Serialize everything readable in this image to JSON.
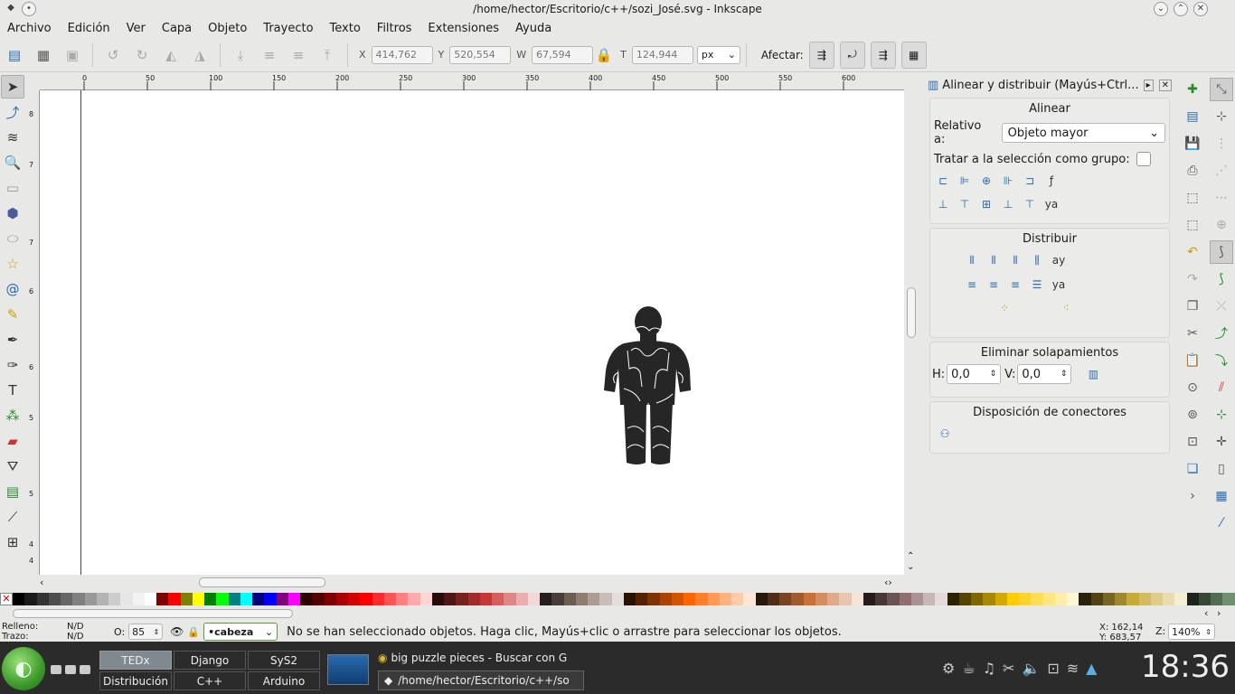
{
  "window": {
    "title": "/home/hector/Escritorio/c++/sozi_José.svg - Inkscape"
  },
  "menu": [
    "Archivo",
    "Edición",
    "Ver",
    "Capa",
    "Objeto",
    "Trayecto",
    "Texto",
    "Filtros",
    "Extensiones",
    "Ayuda"
  ],
  "toolbar": {
    "x_label": "X",
    "x_value": "414,762",
    "y_label": "Y",
    "y_value": "520,554",
    "w_label": "W",
    "w_value": "67,594",
    "h_label": "T",
    "h_value": "124,944",
    "unit": "px",
    "afectar_label": "Afectar:"
  },
  "ruler": {
    "h_ticks": [
      "0",
      "50",
      "100",
      "150",
      "200",
      "250",
      "300",
      "350",
      "400",
      "450",
      "500",
      "550",
      "600"
    ],
    "v_ticks": [
      "8",
      "7",
      "7",
      "6",
      "6",
      "5",
      "5",
      "4",
      "4"
    ]
  },
  "dock": {
    "title": "Alinear y distribuir (Mayús+Ctrl...",
    "align_header": "Alinear",
    "relativo_label": "Relativo a:",
    "relativo_value": "Objeto mayor",
    "grupo_label": "Tratar a la selección como grupo:",
    "distribuir_header": "Distribuir",
    "eliminar_header": "Eliminar solapamientos",
    "h_label": "H:",
    "h_value": "0,0",
    "v_label": "V:",
    "v_value": "0,0",
    "conectores_header": "Disposición de conectores"
  },
  "status": {
    "relleno_label": "Relleno:",
    "relleno_value": "N/D",
    "trazo_label": "Trazo:",
    "trazo_value": "N/D",
    "o_label": "O:",
    "o_value": "85",
    "layer": "•cabeza",
    "message": "No se han seleccionado objetos. Haga clic, Mayús+clic o arrastre para seleccionar los objetos.",
    "cx_label": "X:",
    "cx_value": "162,14",
    "cy_label": "Y:",
    "cy_value": "683,57",
    "zoom_label": "Z:",
    "zoom_value": "140%"
  },
  "taskbar": {
    "desktops": [
      "TEDx",
      "Django",
      "SyS2",
      "Distribución",
      "C++",
      "Arduino"
    ],
    "tasks": [
      "big puzzle pieces - Buscar con G",
      "/home/hector/Escritorio/c++/so"
    ],
    "clock": "18:36"
  },
  "palette": [
    "#000000",
    "#1a1a1a",
    "#333333",
    "#4d4d4d",
    "#666666",
    "#808080",
    "#999999",
    "#b3b3b3",
    "#cccccc",
    "#e6e6e6",
    "#f2f2f2",
    "#ffffff",
    "#800000",
    "#ff0000",
    "#808000",
    "#ffff00",
    "#008000",
    "#00ff00",
    "#008080",
    "#00ffff",
    "#000080",
    "#0000ff",
    "#800080",
    "#ff00ff",
    "#2b0000",
    "#550000",
    "#800000",
    "#aa0000",
    "#d40000",
    "#ff0000",
    "#ff2a2a",
    "#ff5555",
    "#ff8080",
    "#ffaaaa",
    "#ffd5d5",
    "#280b0b",
    "#501616",
    "#782121",
    "#a02c2c",
    "#c83737",
    "#d35f5f",
    "#de8787",
    "#e9afaf",
    "#f4d7d7",
    "#241f1c",
    "#483e37",
    "#6c5d53",
    "#917c6f",
    "#ac9d93",
    "#c8beb7",
    "#e3dedb",
    "#2b1100",
    "#552200",
    "#803300",
    "#aa4400",
    "#d45500",
    "#ff6600",
    "#ff7f2a",
    "#ff9955",
    "#ffb380",
    "#ffccaa",
    "#ffe6d5",
    "#28170b",
    "#502d16",
    "#784421",
    "#a05a2c",
    "#c87137",
    "#d38d5f",
    "#deaa87",
    "#e9c6af",
    "#f4e3d7",
    "#241c1c",
    "#483737",
    "#6c5353",
    "#916f6f",
    "#ac9393",
    "#c8b7b7",
    "#e3dbdb",
    "#2b2200",
    "#554400",
    "#806600",
    "#aa8800",
    "#d4aa00",
    "#ffcc00",
    "#ffd42a",
    "#ffdd55",
    "#ffe680",
    "#ffeeaa",
    "#fff6d5",
    "#28220b",
    "#504416",
    "#786721",
    "#a0892c",
    "#c8ab37",
    "#d3bc5f",
    "#decd87",
    "#e9ddaf",
    "#f4eed7",
    "#1c241c",
    "#374837",
    "#536c53",
    "#6f916f"
  ]
}
